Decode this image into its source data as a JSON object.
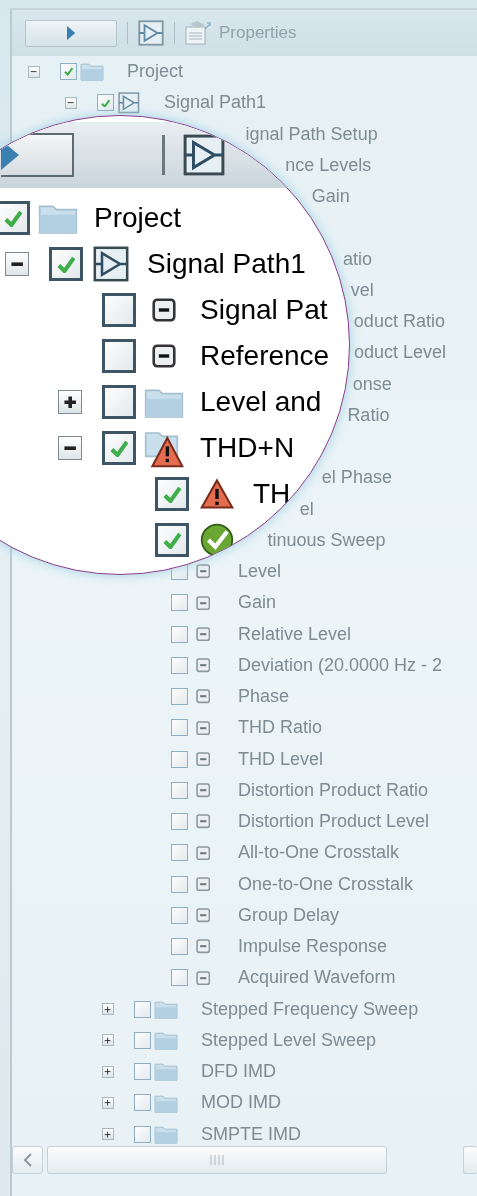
{
  "toolbar": [
    {
      "kind": "play"
    },
    {
      "kind": "signal_path"
    },
    {
      "kind": "properties",
      "label": "Properties",
      "disabled": true
    }
  ],
  "tree": [
    {
      "label": "Project",
      "kind": "folder",
      "expanded": true,
      "checked": true,
      "children": [
        {
          "label": "Signal Path1",
          "kind": "signal_path",
          "expanded": true,
          "checked": true,
          "children": [
            {
              "label": "ignal Path Setup",
              "kind": "partial"
            },
            {
              "label": "nce Levels",
              "kind": "partial"
            },
            {
              "label": "Gain",
              "kind": "partial"
            },
            {
              "kind": "covered",
              "children": [
                {
                  "label": "atio",
                  "kind": "partial"
                },
                {
                  "label": "vel",
                  "kind": "partial"
                },
                {
                  "label": "oduct Ratio",
                  "kind": "partial"
                },
                {
                  "label": "oduct Level",
                  "kind": "partial"
                },
                {
                  "label": "onse",
                  "kind": "partial"
                },
                {
                  "label": "Ratio",
                  "kind": "partial"
                },
                {
                  "kind": "covered"
                },
                {
                  "label": "el Phase",
                  "kind": "partial"
                },
                {
                  "label": "el",
                  "kind": "partial"
                }
              ]
            },
            {
              "label": "tinuous Sweep",
              "kind": "partial",
              "children": [
                {
                  "label": "Level",
                  "kind": "measurement",
                  "checked": false
                },
                {
                  "label": "Gain",
                  "kind": "measurement",
                  "checked": false
                },
                {
                  "label": "Relative Level",
                  "kind": "measurement",
                  "checked": false
                },
                {
                  "label": "Deviation (20.0000 Hz - 2",
                  "kind": "measurement",
                  "checked": false
                },
                {
                  "label": "Phase",
                  "kind": "measurement",
                  "checked": false
                },
                {
                  "label": "THD Ratio",
                  "kind": "measurement",
                  "checked": false
                },
                {
                  "label": "THD Level",
                  "kind": "measurement",
                  "checked": false
                },
                {
                  "label": "Distortion Product Ratio",
                  "kind": "measurement",
                  "checked": false
                },
                {
                  "label": "Distortion Product Level",
                  "kind": "measurement",
                  "checked": false
                },
                {
                  "label": "All-to-One Crosstalk",
                  "kind": "measurement",
                  "checked": false
                },
                {
                  "label": "One-to-One Crosstalk",
                  "kind": "measurement",
                  "checked": false
                },
                {
                  "label": "Group Delay",
                  "kind": "measurement",
                  "checked": false
                },
                {
                  "label": "Impulse Response",
                  "kind": "measurement",
                  "checked": false
                },
                {
                  "label": "Acquired Waveform",
                  "kind": "measurement",
                  "checked": false
                }
              ]
            },
            {
              "label": "Stepped Frequency Sweep",
              "kind": "folder",
              "expanded": false,
              "checked": false
            },
            {
              "label": "Stepped Level Sweep",
              "kind": "folder",
              "expanded": false,
              "checked": false
            },
            {
              "label": "DFD IMD",
              "kind": "folder",
              "expanded": false,
              "checked": false
            },
            {
              "label": "MOD IMD",
              "kind": "folder",
              "expanded": false,
              "checked": false
            },
            {
              "label": "SMPTE IMD",
              "kind": "folder",
              "expanded": false,
              "checked": false
            }
          ]
        }
      ]
    }
  ],
  "magnifier": {
    "toolbar": [
      {
        "kind": "play"
      },
      {
        "kind": "signal_path"
      }
    ],
    "tree": [
      {
        "label": "Project",
        "kind": "folder",
        "checked": true,
        "children": [
          {
            "label": "Signal Path1",
            "kind": "signal_path",
            "expanded": true,
            "checked": true,
            "children": [
              {
                "label": "Signal Pat",
                "kind": "measurement",
                "checked": false
              },
              {
                "label": "Reference",
                "kind": "measurement",
                "checked": false
              },
              {
                "label": "Level and",
                "kind": "folder",
                "expanded": false,
                "checked": false
              },
              {
                "label": "THD+N",
                "kind": "warning_folder",
                "expanded": true,
                "checked": true,
                "children": [
                  {
                    "label": "TH",
                    "kind": "warning",
                    "checked": true
                  },
                  {
                    "kind": "ok",
                    "checked": true
                  }
                ]
              }
            ]
          }
        ]
      }
    ]
  }
}
